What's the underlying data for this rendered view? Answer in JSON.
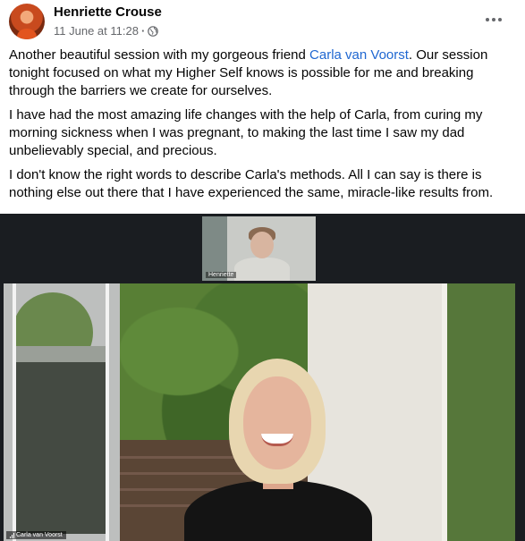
{
  "post": {
    "author": "Henriette Crouse",
    "date": "11 June at 11:28",
    "separator": "·",
    "privacy_icon": "globe-icon",
    "more_icon": "more-options-icon",
    "text": {
      "p1_before": "Another beautiful session with my gorgeous friend ",
      "p1_link": "Carla van Voorst",
      "p1_after": ". Our session tonight focused on what my Higher Self knows is possible for me and breaking through the barriers we create for ourselves.",
      "p2": "I have had the most amazing life changes with the help of Carla, from curing my morning sickness when I was pregnant, to making the last time I saw my dad unbelievably special, and precious.",
      "p3": "I don't know the right words to describe Carla's methods. All I can say is there is nothing else out there that I have experienced the same, miracle-like results from."
    }
  },
  "video": {
    "thumbnail_name": "Henriette",
    "main_name": "Carla van Voorst"
  },
  "colors": {
    "link": "#1f67d1",
    "meta_text": "#65676b",
    "video_bg": "#1a1d21"
  }
}
